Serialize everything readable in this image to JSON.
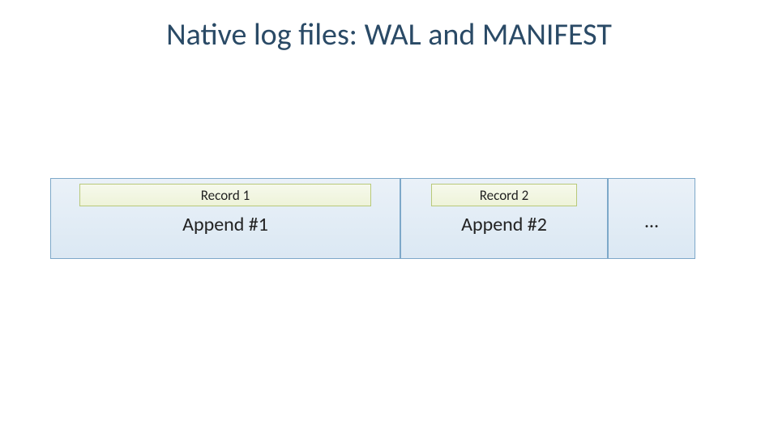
{
  "title": "Native log files: WAL and MANIFEST",
  "blocks": {
    "b1": {
      "record_label": "Record 1",
      "append_label": "Append #1"
    },
    "b2": {
      "record_label": "Record 2",
      "append_label": "Append #2"
    },
    "b3": {
      "ellipsis": "…"
    }
  }
}
